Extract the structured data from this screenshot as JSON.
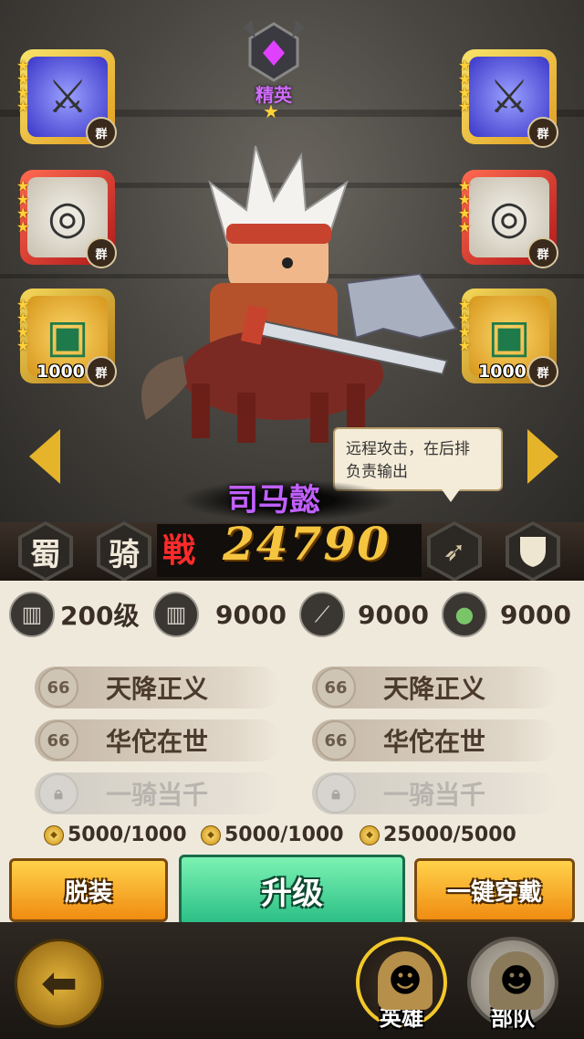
{
  "rank": {
    "label": "精英",
    "star": "★"
  },
  "slots": [
    {
      "id": "left-1",
      "rarity": "purple",
      "stars": 4,
      "faction": "群",
      "icon": "axe-icon",
      "count": ""
    },
    {
      "id": "left-2",
      "rarity": "red",
      "stars": 4,
      "faction": "群",
      "icon": "ring-icon",
      "count": ""
    },
    {
      "id": "left-3",
      "rarity": "gold",
      "stars": 4,
      "faction": "群",
      "icon": "book-icon",
      "count": "1000"
    },
    {
      "id": "right-1",
      "rarity": "purple",
      "stars": 4,
      "faction": "群",
      "icon": "axe-icon",
      "count": ""
    },
    {
      "id": "right-2",
      "rarity": "red",
      "stars": 4,
      "faction": "群",
      "icon": "ring-icon",
      "count": ""
    },
    {
      "id": "right-3",
      "rarity": "gold",
      "stars": 4,
      "faction": "群",
      "icon": "book-icon",
      "count": "1000"
    }
  ],
  "tooltip": {
    "line1": "远程攻击，在后排",
    "line2": "负责输出"
  },
  "hero": {
    "name": "司马懿",
    "faction": "蜀",
    "type": "骑",
    "power_label": "戦",
    "power": "24790",
    "role_icon": "bow-icon",
    "shield_icon": "shield-icon"
  },
  "stats": [
    {
      "icon": "level-book-icon",
      "value": "200级"
    },
    {
      "icon": "armor-book-icon",
      "value": "9000"
    },
    {
      "icon": "blade-icon",
      "value": "9000"
    },
    {
      "icon": "troops-icon",
      "value": "9000"
    }
  ],
  "skills": [
    {
      "level": "66",
      "name": "天降正义",
      "locked": false
    },
    {
      "level": "66",
      "name": "天降正义",
      "locked": false
    },
    {
      "level": "66",
      "name": "华佗在世",
      "locked": false
    },
    {
      "level": "66",
      "name": "华佗在世",
      "locked": false
    },
    {
      "level": "",
      "name": "一骑当千",
      "locked": true
    },
    {
      "level": "",
      "name": "一骑当千",
      "locked": true
    }
  ],
  "costs": [
    "5000/1000",
    "5000/1000",
    "25000/5000"
  ],
  "buttons": {
    "unequip": "脱装",
    "upgrade": "升级",
    "equip_all": "一键穿戴"
  },
  "nav": {
    "hero": "英雄",
    "troops": "部队"
  },
  "colors": {
    "gold": "#f5c540",
    "hero_name": "#c060ff",
    "upgrade": "#2bbf86",
    "panel": "#efe9dc"
  }
}
